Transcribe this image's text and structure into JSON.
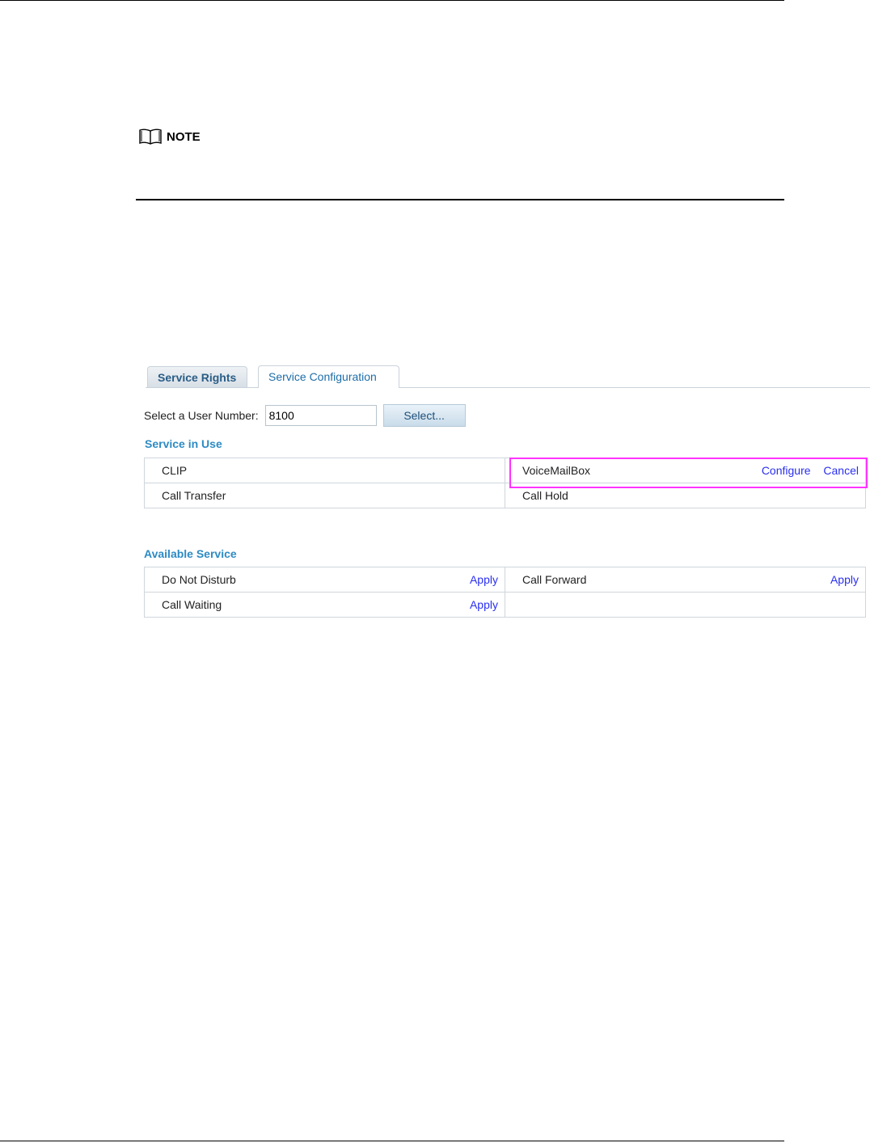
{
  "note": {
    "label": "NOTE"
  },
  "tabs": [
    {
      "label": "Service Rights",
      "active": false
    },
    {
      "label": "Service Configuration",
      "active": true
    }
  ],
  "user_number": {
    "label": "Select a User Number:",
    "value": "8100",
    "button": "Select..."
  },
  "service_in_use": {
    "title": "Service in Use",
    "rows": [
      {
        "left": "CLIP",
        "right": "VoiceMailBox",
        "right_actions": [
          "Configure",
          "Cancel"
        ]
      },
      {
        "left": "Call Transfer",
        "right": "Call Hold"
      }
    ]
  },
  "available_service": {
    "title": "Available Service",
    "rows": [
      {
        "left": "Do Not Disturb",
        "left_action": "Apply",
        "right": "Call Forward",
        "right_action": "Apply"
      },
      {
        "left": "Call Waiting",
        "left_action": "Apply",
        "right": ""
      }
    ]
  },
  "colors": {
    "accent": "#2d8bc4",
    "link": "#2a2ff0",
    "highlight": "#ff33ff"
  }
}
